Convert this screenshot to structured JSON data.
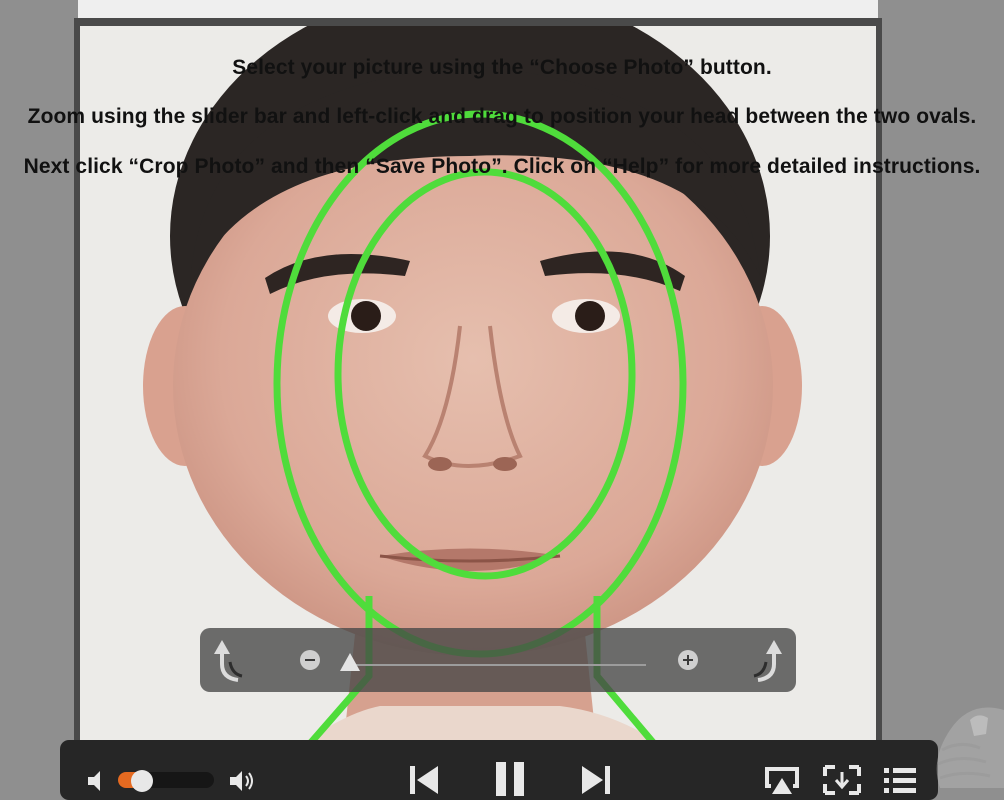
{
  "instructions": {
    "line1": "Select your picture using the “Choose Photo” button.",
    "line2": "Zoom using the slider bar and left-click and drag to position your head between the two ovals.",
    "line3": "Next click “Crop Photo” and then “Save Photo”.  Click on “Help” for more detailed instructions."
  },
  "zoom_control": {
    "rotate_left_icon": "rotate-left-icon",
    "rotate_right_icon": "rotate-right-icon",
    "zoom_out_icon": "minus-circle-icon",
    "zoom_in_icon": "plus-circle-icon",
    "zoom_level": 0
  },
  "player": {
    "volume_level": 0.25,
    "icons": [
      "speaker-low-icon",
      "speaker-high-icon",
      "skip-back-icon",
      "pause-icon",
      "skip-forward-icon",
      "airplay-icon",
      "fullscreen-icon",
      "playlist-icon"
    ]
  },
  "colors": {
    "guide": "#4fdc3b",
    "accent": "#e46a21"
  }
}
